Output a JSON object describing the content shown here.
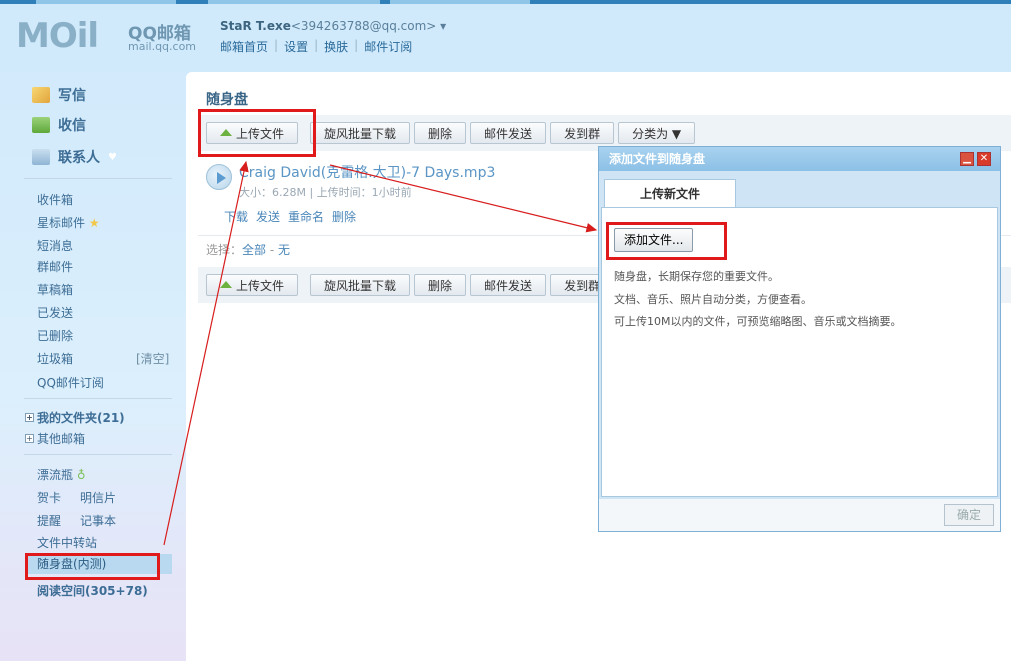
{
  "logo": {
    "mark": "MOil",
    "brand": "QQ邮箱",
    "url": "mail.qq.com"
  },
  "user": {
    "nickname": "StaR T.exe",
    "email": "<394263788@qq.com>",
    "dropdown": "▾"
  },
  "top_nav": [
    "邮箱首页",
    "设置",
    "换肤",
    "邮件订阅"
  ],
  "sidebar": {
    "compose": "写信",
    "inbox_check": "收信",
    "contacts": "联系人",
    "items": [
      "收件箱",
      "星标邮件",
      "短消息",
      "群邮件",
      "草稿箱",
      "已发送",
      "已删除",
      "垃圾箱",
      "QQ邮件订阅"
    ],
    "clear_label": "[清空]",
    "folders": "我的文件夹(21)",
    "other_mailbox": "其他邮箱",
    "apps": {
      "bottle": "漂流瓶",
      "card": "贺卡",
      "postcard": "明信片",
      "reminder": "提醒",
      "notebook": "记事本",
      "transfer": "文件中转站",
      "drive": "随身盘(内测)",
      "reading": "阅读空间(305+78)"
    }
  },
  "main": {
    "title": "随身盘",
    "toolbar": {
      "upload": "上传文件",
      "batch_download": "旋风批量下载",
      "delete": "删除",
      "mail_send": "邮件发送",
      "send_group": "发到群",
      "classify": "分类为 ▼"
    },
    "toolbar_bottom_send_group": "发到群",
    "file": {
      "name": "Craig David(克雷格.大卫)-7 Days.mp3",
      "meta": "大小：6.28M | 上传时间：1小时前",
      "actions": [
        "下载",
        "发送",
        "重命名",
        "删除"
      ]
    },
    "select": {
      "label": "选择：",
      "all": "全部",
      "dash": " - ",
      "none": "无"
    }
  },
  "dialog": {
    "title": "添加文件到随身盘",
    "minimize": "▁",
    "close": "✕",
    "tab": "上传新文件",
    "add_button": "添加文件...",
    "lines": [
      "随身盘，长期保存您的重要文件。",
      "文档、音乐、照片自动分类，方便查看。",
      "可上传10M以内的文件，可预览缩略图、音乐或文档摘要。"
    ],
    "ok": "确定"
  },
  "colors": {
    "highlight": "#e0191b",
    "link": "#4a86b8",
    "sidebar_text": "#3d6d95"
  }
}
